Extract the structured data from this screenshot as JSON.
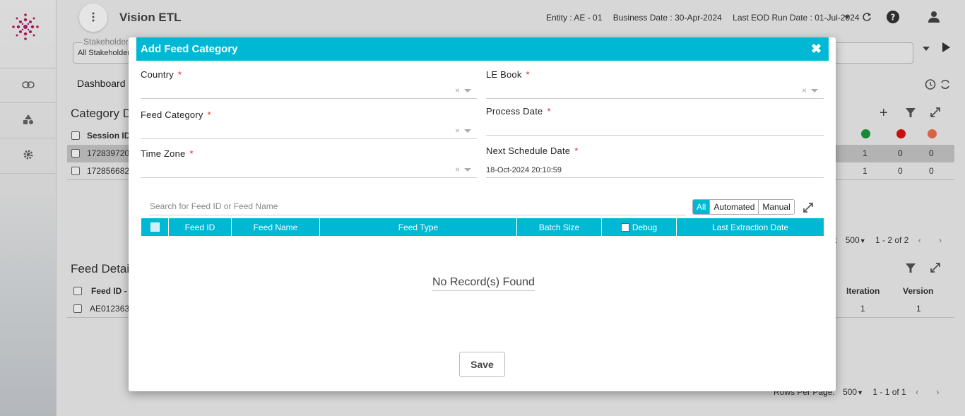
{
  "app": {
    "title": "Vision ETL"
  },
  "header": {
    "entity_label": "Entity : AE - 01",
    "business_date_label": "Business Date : 30-Apr-2024",
    "last_eod_label": "Last EOD Run Date : 01-Jul-2024"
  },
  "filter": {
    "stakeholder_label": "Stakeholder",
    "stakeholder_value": "All Stakeholder",
    "search_placeholder": "e"
  },
  "tabs": {
    "dashboard": "Dashboard"
  },
  "category_section": {
    "title": "Category D",
    "header_col": "Session ID",
    "rows": [
      {
        "id": "172839720",
        "c1": "1",
        "c2": "0",
        "c3": "0"
      },
      {
        "id": "172856682",
        "c1": "1",
        "c2": "0",
        "c3": "0"
      }
    ],
    "pager": {
      "rows_value": "500",
      "range": "1 - 2 of 2",
      "rows_suffix": ":"
    },
    "status_colors": [
      "#1a9a3a",
      "#e01010",
      "#f07050"
    ]
  },
  "feed_section": {
    "title": "Feed Detai",
    "header_col": "Feed ID -",
    "col_iteration": "Iteration",
    "col_version": "Version",
    "rows": [
      {
        "id": "AE012363",
        "iteration": "1",
        "version": "1"
      }
    ],
    "pager": {
      "rows_label": "Rows Per Page:",
      "rows_value": "500",
      "range": "1 - 1 of 1"
    }
  },
  "dialog": {
    "title": "Add Feed Category",
    "close_glyph": "✖",
    "fields": {
      "country": {
        "label": "Country",
        "required": "*",
        "clear": "×"
      },
      "le_book": {
        "label": "LE Book",
        "required": "*",
        "clear": "×"
      },
      "feed_category": {
        "label": "Feed Category",
        "required": "*",
        "clear": "×"
      },
      "process_date": {
        "label": "Process Date",
        "required": "*",
        "value": ""
      },
      "time_zone": {
        "label": "Time Zone",
        "required": "*",
        "clear": "×"
      },
      "next_schedule": {
        "label": "Next Schedule Date",
        "required": "*",
        "value": "18-Oct-2024 20:10:59"
      }
    },
    "search_placeholder": "Search for Feed ID or Feed Name",
    "filter_buttons": {
      "all": "All",
      "automated": "Automated",
      "manual": "Manual"
    },
    "grid_columns": {
      "feed_id": "Feed ID",
      "feed_name": "Feed Name",
      "feed_type": "Feed Type",
      "batch_size": "Batch Size",
      "debug": "Debug",
      "last_extraction": "Last Extraction Date"
    },
    "empty_text": "No Record(s) Found",
    "save_label": "Save"
  },
  "colors": {
    "accent": "#00b8d4",
    "required": "#d32f2f"
  },
  "icons": [
    "logo-icon",
    "link-icon",
    "shapes-icon",
    "gear-icon",
    "kebab-icon",
    "refresh-icon",
    "help-icon",
    "user-icon",
    "history-icon",
    "sync-icon",
    "plus-icon",
    "filter-icon",
    "expand-icon"
  ]
}
